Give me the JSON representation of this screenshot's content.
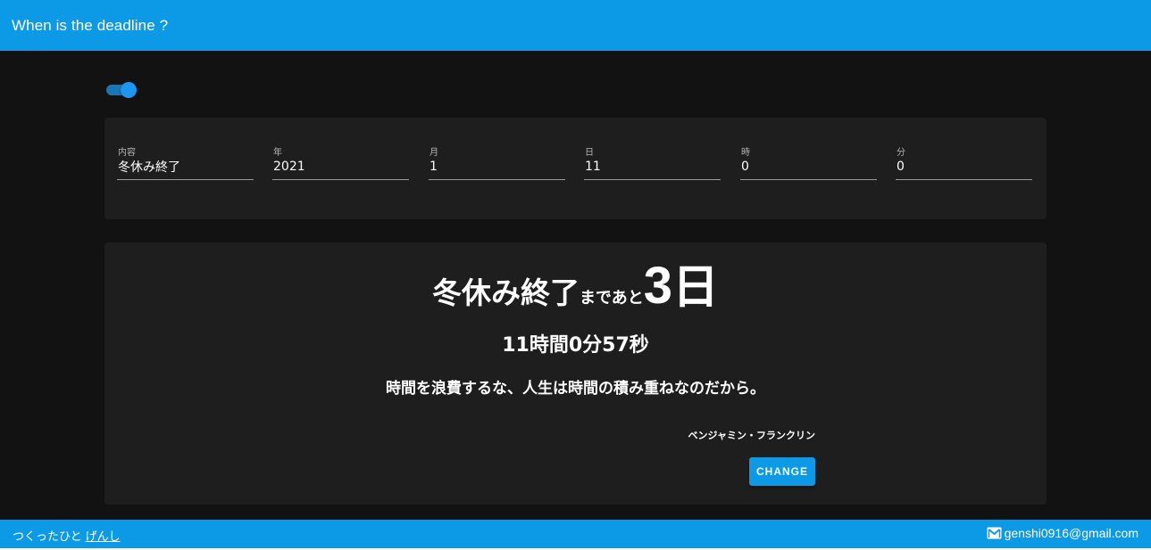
{
  "appbar": {
    "title": "When is the deadline ?"
  },
  "toggle": {
    "state": "on",
    "accent_color": "#1d96ef"
  },
  "form": {
    "fields": [
      {
        "label": "内容",
        "value": "冬休み終了"
      },
      {
        "label": "年",
        "value": "2021"
      },
      {
        "label": "月",
        "value": "1"
      },
      {
        "label": "日",
        "value": "11"
      },
      {
        "label": "時",
        "value": "0"
      },
      {
        "label": "分",
        "value": "0"
      }
    ]
  },
  "result": {
    "event": "冬休み終了",
    "middle_text": "まであと",
    "days": "3",
    "days_unit": "日",
    "remaining": "11時間0分57秒",
    "quote": "時間を浪費するな、人生は時間の積み重ねなのだから。",
    "author": "ベンジャミン・フランクリン",
    "change_label": "CHANGE"
  },
  "footer": {
    "made_by_label": "つくったひと",
    "author_link": "げんし",
    "email": "genshi0916@gmail.com",
    "email_icon": "mail-icon"
  },
  "colors": {
    "primary": "#0c9ae6",
    "background": "#121212",
    "surface": "#1e1e1e"
  }
}
